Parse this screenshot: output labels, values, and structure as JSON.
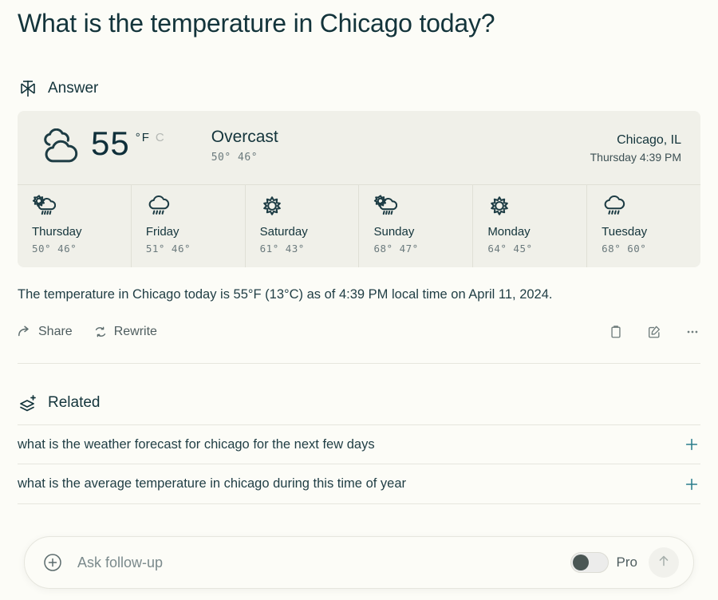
{
  "question": "What is the temperature in Chicago today?",
  "answer_section": {
    "icon": "perplexity-answer-icon",
    "label": "Answer"
  },
  "weather": {
    "icon": "overcast-clouds-icon",
    "temperature": "55",
    "degree_symbol": "°",
    "unit_f": "F",
    "unit_c": "C",
    "active_unit": "F",
    "condition": "Overcast",
    "high_low": "50°  46°",
    "location": "Chicago, IL",
    "local_time": "Thursday 4:39 PM",
    "forecast": [
      {
        "day": "Thursday",
        "icon": "sun-rain-cloud-icon",
        "range": "50°  46°"
      },
      {
        "day": "Friday",
        "icon": "rain-cloud-icon",
        "range": "51°  46°"
      },
      {
        "day": "Saturday",
        "icon": "sun-icon",
        "range": "61°  43°"
      },
      {
        "day": "Sunday",
        "icon": "sun-rain-cloud-icon",
        "range": "68°  47°"
      },
      {
        "day": "Monday",
        "icon": "sun-icon",
        "range": "64°  45°"
      },
      {
        "day": "Tuesday",
        "icon": "rain-cloud-icon",
        "range": "68°  60°"
      }
    ]
  },
  "answer_text": "The temperature in Chicago today is 55°F (13°C) as of 4:39 PM local time on April 11, 2024.",
  "actions": {
    "share_label": "Share",
    "rewrite_label": "Rewrite",
    "copy_icon": "clipboard-icon",
    "edit_icon": "edit-square-icon",
    "more_icon": "ellipsis-icon"
  },
  "related_section": {
    "icon": "layers-plus-icon",
    "label": "Related",
    "items": [
      "what is the weather forecast for chicago for the next few days",
      "what is the average temperature in chicago during this time of year"
    ]
  },
  "followup": {
    "add_icon": "plus-circle-icon",
    "placeholder": "Ask follow-up",
    "value": "",
    "pro_label": "Pro",
    "pro_enabled": false,
    "send_icon": "arrow-up-icon"
  },
  "colors": {
    "page_bg": "#fcfcf7",
    "card_bg": "#f0f0e9",
    "text": "#13343b",
    "accent_teal": "#2a7d8c",
    "muted": "#6b7a7d"
  }
}
